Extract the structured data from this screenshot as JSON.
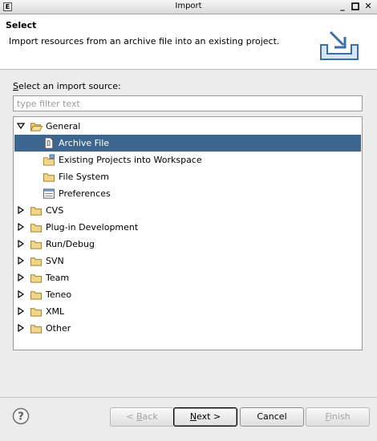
{
  "window": {
    "title": "Import",
    "app_icon": "E"
  },
  "banner": {
    "heading": "Select",
    "description": "Import resources from an archive file into an existing project."
  },
  "source": {
    "label_mnemonic": "S",
    "label_rest": "elect an import source:",
    "filter_placeholder": "type filter text"
  },
  "tree": [
    {
      "label": "General",
      "icon": "folder-open-icon",
      "expanded": true
    },
    {
      "label": "Archive File",
      "icon": "archive-file-icon",
      "selected": true
    },
    {
      "label": "Existing Projects into Workspace",
      "icon": "project-icon"
    },
    {
      "label": "File System",
      "icon": "folder-icon"
    },
    {
      "label": "Preferences",
      "icon": "preferences-icon"
    },
    {
      "label": "CVS",
      "icon": "folder-icon",
      "expanded": false
    },
    {
      "label": "Plug-in Development",
      "icon": "folder-icon",
      "expanded": false
    },
    {
      "label": "Run/Debug",
      "icon": "folder-icon",
      "expanded": false
    },
    {
      "label": "SVN",
      "icon": "folder-icon",
      "expanded": false
    },
    {
      "label": "Team",
      "icon": "folder-icon",
      "expanded": false
    },
    {
      "label": "Teneo",
      "icon": "folder-icon",
      "expanded": false
    },
    {
      "label": "XML",
      "icon": "folder-icon",
      "expanded": false
    },
    {
      "label": "Other",
      "icon": "folder-icon",
      "expanded": false
    }
  ],
  "buttons": {
    "back": {
      "pre": "< ",
      "mn": "B",
      "post": "ack",
      "enabled": false
    },
    "next": {
      "pre": "",
      "mn": "N",
      "post": "ext >",
      "enabled": true
    },
    "cancel": {
      "label": "Cancel",
      "enabled": true
    },
    "finish": {
      "pre": "",
      "mn": "F",
      "post": "inish",
      "enabled": false
    }
  },
  "colors": {
    "selection": "#3d668f",
    "accent": "#4a7fb5"
  }
}
